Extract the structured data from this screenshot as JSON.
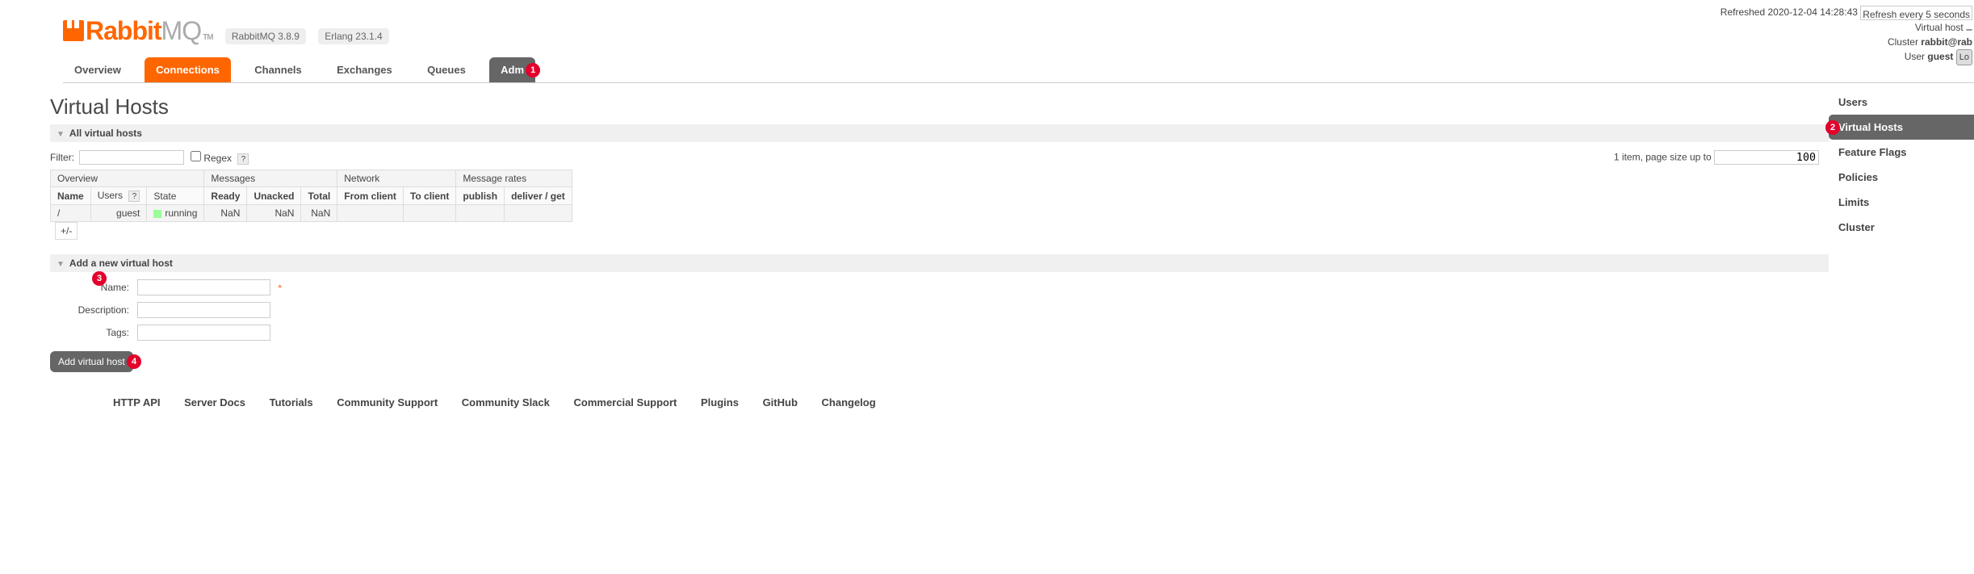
{
  "status": {
    "refreshed_prefix": "Refreshed ",
    "refreshed_time": "2020-12-04 14:28:43",
    "refresh_option": "Refresh every 5 seconds",
    "vhost_label": "Virtual host",
    "cluster_label": "Cluster ",
    "cluster_name": "rabbit@rab",
    "user_label": "User ",
    "user_name": "guest",
    "logout": "Lo"
  },
  "logo": {
    "rabbit": "Rabbit",
    "mq": "MQ",
    "tm": "TM"
  },
  "versions": {
    "rabbitmq": "RabbitMQ 3.8.9",
    "erlang": "Erlang 23.1.4"
  },
  "tabs": {
    "overview": "Overview",
    "connections": "Connections",
    "channels": "Channels",
    "exchanges": "Exchanges",
    "queues": "Queues",
    "admin": "Adm"
  },
  "page": {
    "title": "Virtual Hosts"
  },
  "sections": {
    "all_vhosts": "All virtual hosts",
    "add_vhost": "Add a new virtual host"
  },
  "filter": {
    "label": "Filter:",
    "value": "",
    "regex_label": "Regex",
    "help": "?"
  },
  "pager": {
    "text": "1 item, page size up to",
    "value": "100"
  },
  "table": {
    "groups": {
      "overview": "Overview",
      "messages": "Messages",
      "network": "Network",
      "msgrates": "Message rates",
      "plusminus": "+/-"
    },
    "cols": {
      "name": "Name",
      "users": "Users",
      "state": "State",
      "ready": "Ready",
      "unacked": "Unacked",
      "total": "Total",
      "from_client": "From client",
      "to_client": "To client",
      "publish": "publish",
      "deliver_get": "deliver / get"
    },
    "row": {
      "name": "/",
      "users": "guest",
      "state": "running",
      "ready": "NaN",
      "unacked": "NaN",
      "total": "NaN",
      "from_client": "",
      "to_client": "",
      "publish": "",
      "deliver_get": ""
    }
  },
  "form": {
    "name_label": "Name:",
    "description_label": "Description:",
    "tags_label": "Tags:",
    "name_value": "",
    "description_value": "",
    "tags_value": "",
    "required": "*",
    "submit": "Add virtual host"
  },
  "sidebar": {
    "items": [
      {
        "label": "Users"
      },
      {
        "label": "Virtual Hosts"
      },
      {
        "label": "Feature Flags"
      },
      {
        "label": "Policies"
      },
      {
        "label": "Limits"
      },
      {
        "label": "Cluster"
      }
    ]
  },
  "footer": {
    "links": [
      "HTTP API",
      "Server Docs",
      "Tutorials",
      "Community Support",
      "Community Slack",
      "Commercial Support",
      "Plugins",
      "GitHub",
      "Changelog"
    ]
  },
  "badges": {
    "b1": "1",
    "b2": "2",
    "b3": "3",
    "b4": "4"
  }
}
